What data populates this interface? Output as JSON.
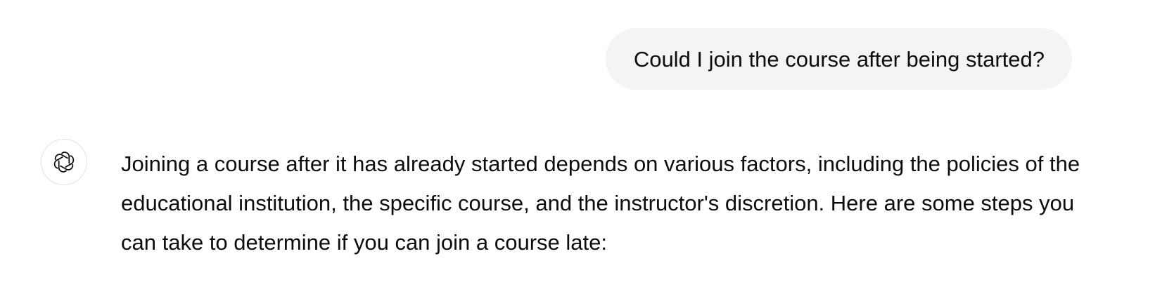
{
  "conversation": {
    "user_message": "Could I join the course after being started?",
    "assistant_message": "Joining a course after it has already started depends on various factors, including the policies of the educational institution, the specific course, and the instructor's discretion. Here are some steps you can take to determine if you can join a course late:",
    "assistant_avatar_icon": "openai-logo-icon"
  },
  "colors": {
    "user_bubble_bg": "#f4f4f4",
    "text": "#0d0d0d",
    "avatar_border": "#e3e3e3",
    "background": "#ffffff"
  }
}
